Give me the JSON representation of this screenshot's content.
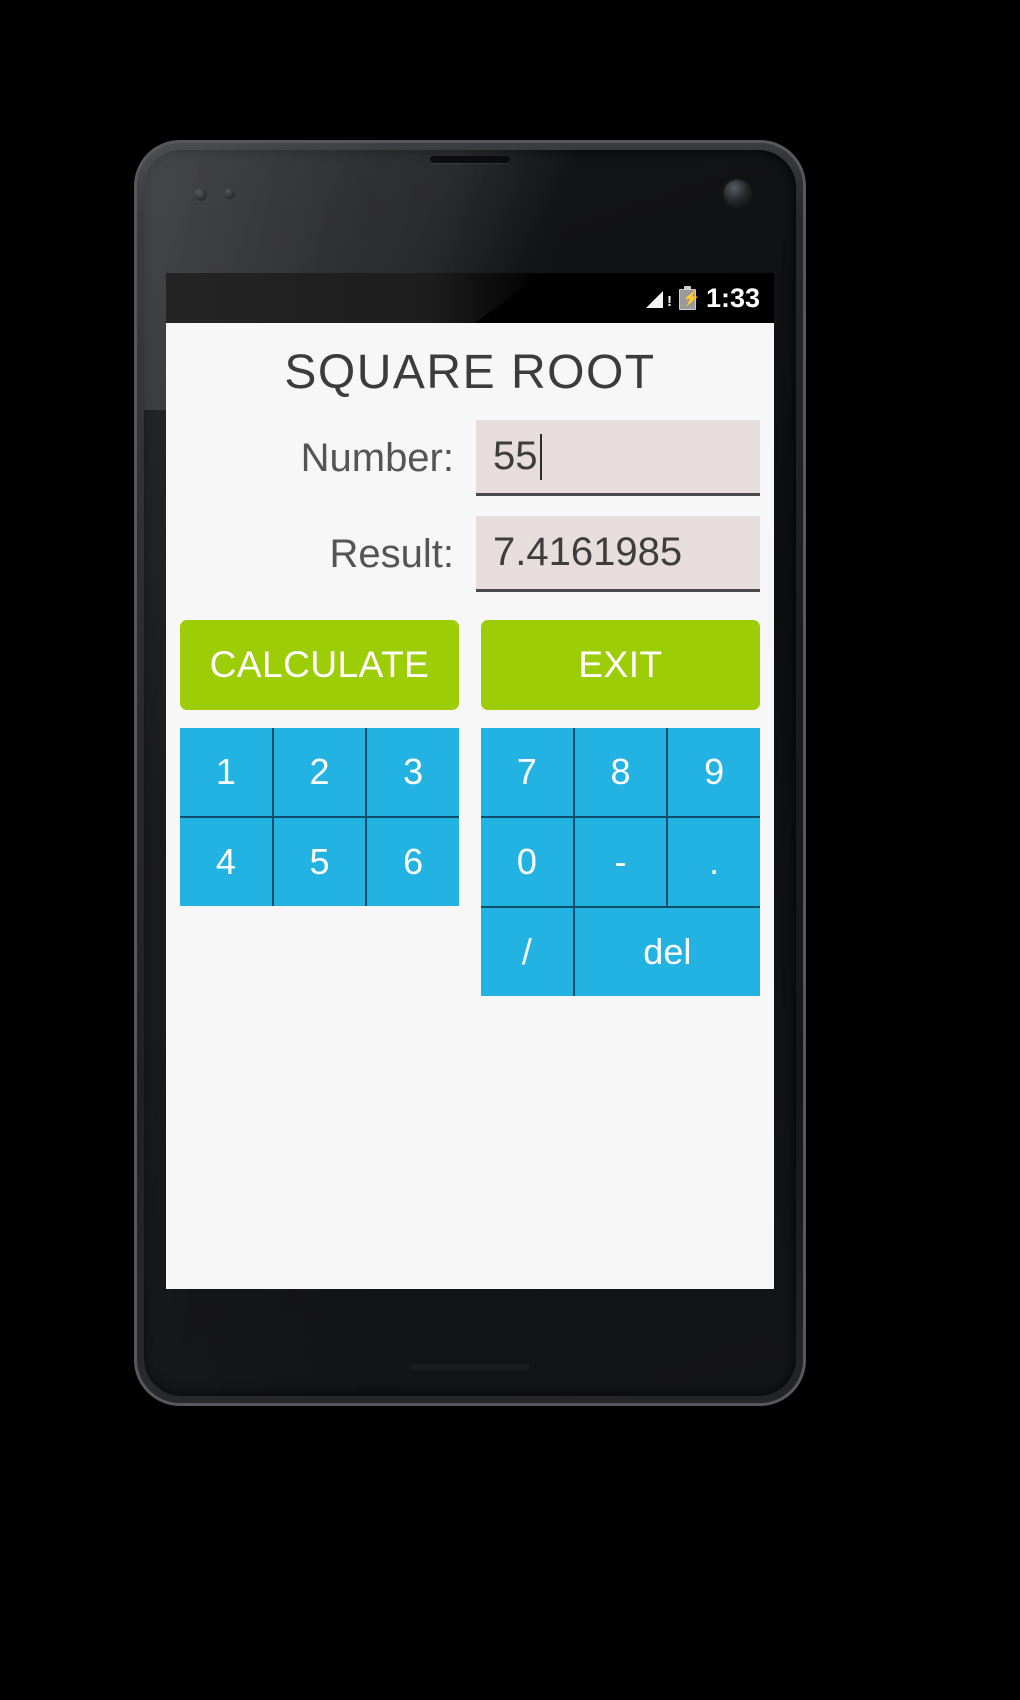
{
  "device": {
    "type": "android-phone",
    "earpiece": "earpiece-grille",
    "camera": "front-camera",
    "sensors": [
      "proximity-sensor",
      "light-sensor"
    ]
  },
  "statusbar": {
    "signal_icon": "signal-no-service-icon",
    "signal_badge": "!",
    "battery_icon": "battery-charging-icon",
    "battery_bolt": "⚡",
    "time": "1:33"
  },
  "app": {
    "title": "SQUARE ROOT",
    "fields": [
      {
        "label": "Number:",
        "value": "55",
        "placeholder": "",
        "focused": true,
        "readonly": false
      },
      {
        "label": "Result:",
        "value": "7.4161985",
        "placeholder": "",
        "focused": false,
        "readonly": true
      }
    ],
    "actions": [
      {
        "label": "CALCULATE"
      },
      {
        "label": "EXIT"
      }
    ],
    "keypad_left": [
      "1",
      "2",
      "3",
      "4",
      "5",
      "6"
    ],
    "keypad_right": [
      "7",
      "8",
      "9",
      "0",
      "-",
      ".",
      "/",
      "del"
    ],
    "colors": {
      "accent_green": "#9ccd07",
      "accent_blue": "#22b3e3",
      "keypad_divider": "#0d4f6b",
      "field_bg": "#e7dddc",
      "screen_bg": "#f7f7f7",
      "text": "#555555"
    }
  }
}
